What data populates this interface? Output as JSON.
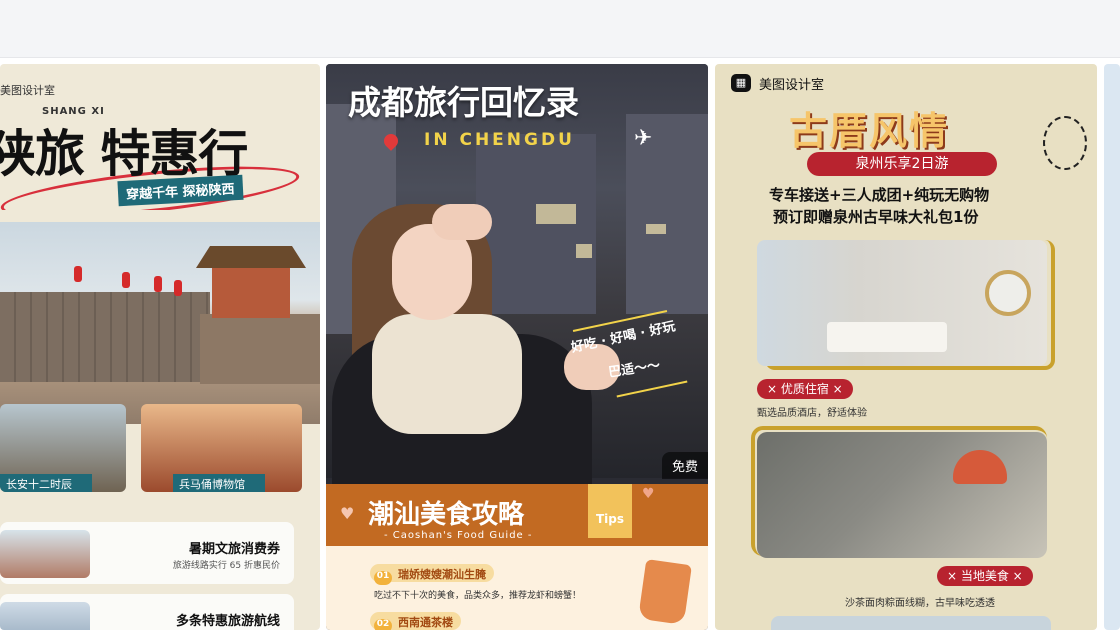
{
  "cards": [
    {
      "brand": "美图设计室",
      "pinyin": "SHANG XI",
      "title": "陕旅 特惠行",
      "tagline": "穿越千年 探秘陕西",
      "thumbs": [
        "长安十二时辰",
        "兵马俑博物馆"
      ],
      "panels": [
        {
          "title": "暑期文旅消费券",
          "sub": "旅游线路实行 65 折惠民价"
        },
        {
          "title": "多条特惠旅游航线",
          "sub": ""
        }
      ]
    },
    {
      "title": "成都旅行回忆录",
      "subtitle": "IN CHENGDU",
      "slogan_line1": "好吃 · 好喝 · 好玩",
      "slogan_line2": "巴适～～",
      "price_tag": "免费",
      "food": {
        "title": "潮汕美食攻略",
        "subtitle": "- Caoshan's Food Guide -",
        "tips": "Tips",
        "items": [
          {
            "num": "01",
            "label": "瑞娇嫂嫂潮汕生腌"
          },
          {
            "num": "02",
            "label": "西南通茶楼"
          }
        ],
        "desc": "吃过不下十次的美食，品类众多，推荐龙虾和螃蟹！"
      }
    },
    {
      "brand": "美图设计室",
      "title": "古厝风情",
      "pill": "泉州乐享2日游",
      "line1": "专车接送+三人成团+纯玩无购物",
      "line2": "预订即赠泉州古早味大礼包1份",
      "badge1": "× 优质住宿 ×",
      "desc1": "甄选品质酒店，舒适体验",
      "badge2": "× 当地美食 ×",
      "desc2": "沙茶面肉粽面线糊，古早味吃透透"
    }
  ]
}
